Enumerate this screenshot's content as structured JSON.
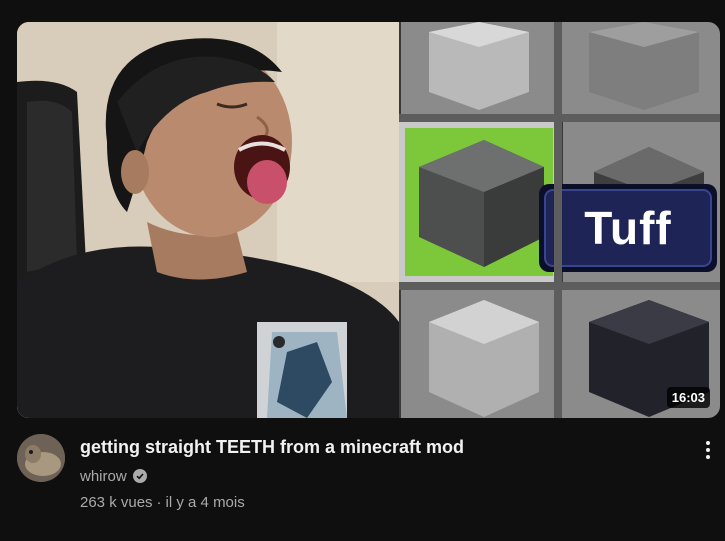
{
  "video": {
    "title": "getting straight TEETH from a minecraft mod",
    "duration": "16:03",
    "thumbnail_text": "Tuff",
    "channel": "whirow",
    "verified": true,
    "views": "263 k vues",
    "separator": "·",
    "age": "il y a 4 mois"
  },
  "colors": {
    "background": "#0f0f0f",
    "title": "#f1f1f1",
    "secondary_text": "#aaaaaa",
    "tuff_label_bg": "#1e2455",
    "highlight_tile": "#7cc83a"
  },
  "icons": {
    "menu": "more-vertical-icon",
    "verified": "verified-check-icon"
  }
}
